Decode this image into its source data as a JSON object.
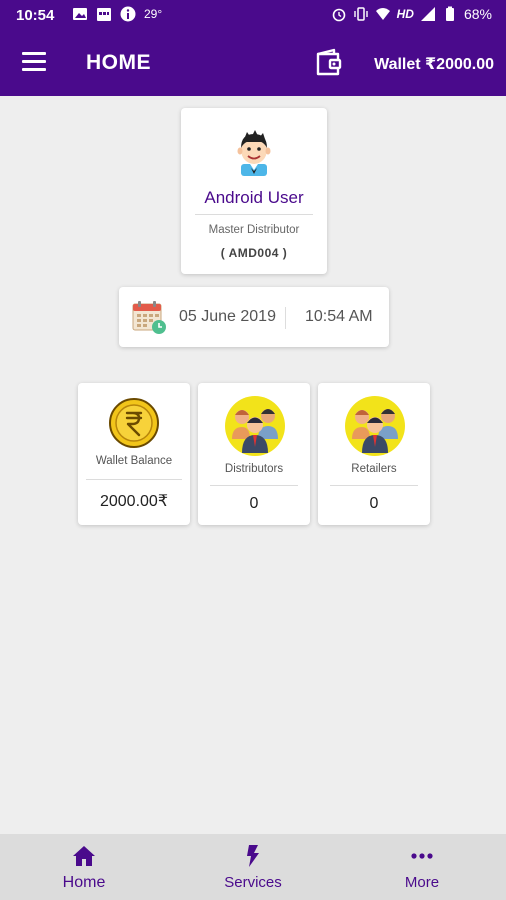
{
  "status_bar": {
    "time": "10:54",
    "temperature": "29°",
    "network": "HD",
    "battery": "68%"
  },
  "app_bar": {
    "title": "HOME",
    "wallet_label": "Wallet ₹2000.00"
  },
  "profile": {
    "name": "Android User",
    "role": "Master Distributor",
    "code": "( AMD004 )"
  },
  "datetime": {
    "date": "05 June 2019",
    "time": "10:54 AM"
  },
  "stats": [
    {
      "label": "Wallet Balance",
      "value": "2000.00₹",
      "icon": "rupee-coin-icon"
    },
    {
      "label": "Distributors",
      "value": "0",
      "icon": "distributors-group-icon"
    },
    {
      "label": "Retailers",
      "value": "0",
      "icon": "retailers-group-icon"
    }
  ],
  "bottom_nav": {
    "items": [
      {
        "label": "Home",
        "icon": "home-icon",
        "active": true
      },
      {
        "label": "Services",
        "icon": "lightning-icon",
        "active": false
      },
      {
        "label": "More",
        "icon": "more-dots-icon",
        "active": false
      }
    ]
  },
  "colors": {
    "primary": "#4a0a8c",
    "background": "#eeeeee",
    "nav_background": "#dcdcdc",
    "coin_yellow": "#f2c51a"
  }
}
